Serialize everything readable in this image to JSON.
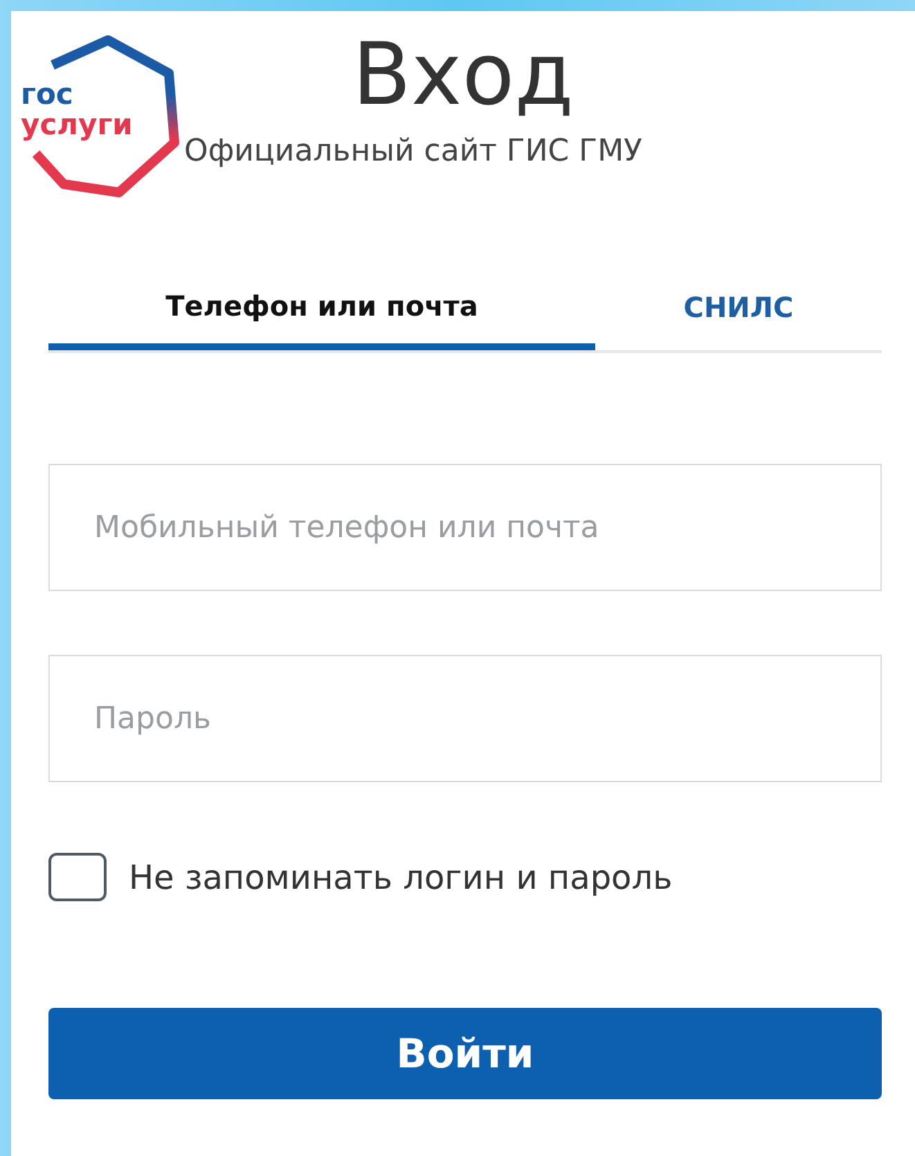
{
  "logo": {
    "lines": [
      "гос",
      "услуги"
    ]
  },
  "title": "Вход",
  "subtitle": "Официальный сайт ГИС ГМУ",
  "tabs": [
    {
      "label": "Телефон или почта",
      "selected": true
    },
    {
      "label": "СНИЛС",
      "selected": false
    }
  ],
  "fields": [
    {
      "placeholder": "Мобильный телефон или почта"
    },
    {
      "placeholder": "Пароль"
    }
  ],
  "remember": {
    "label": "Не запоминать логин и пароль",
    "checked": false
  },
  "submit": "Войти"
}
